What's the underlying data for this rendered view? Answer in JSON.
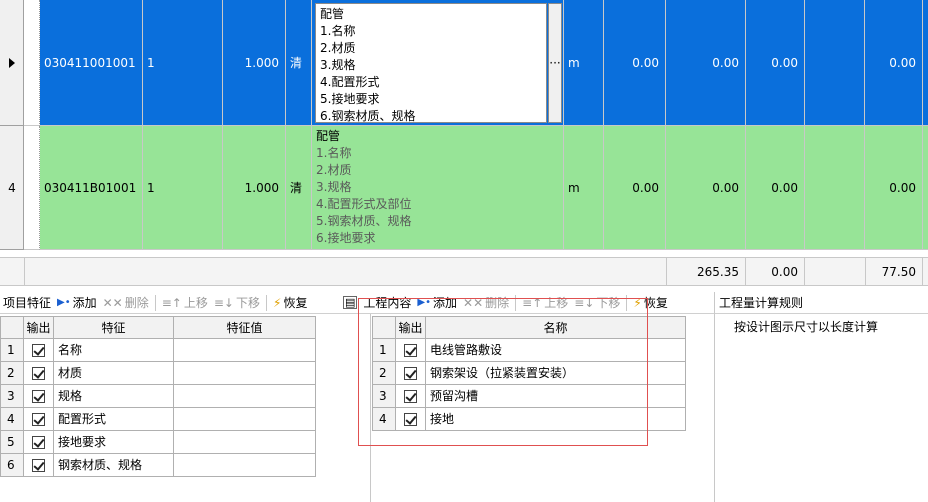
{
  "rows": [
    {
      "row_num": "",
      "code": "030411001001",
      "qty": "1",
      "amount": "1.000",
      "type": "清",
      "desc_title": "配管",
      "desc_items": [
        "1.名称",
        "2.材质",
        "3.规格",
        "4.配置形式",
        "5.接地要求",
        "6.钢索材质、规格"
      ],
      "ellipsis": "···",
      "unit": "m",
      "v1": "0.00",
      "v2": "0.00",
      "v3": "0.00",
      "v4": "0.00"
    },
    {
      "row_num": "4",
      "code": "030411B01001",
      "qty": "1",
      "amount": "1.000",
      "type": "清",
      "desc_title": "配管",
      "desc_items": [
        "1.名称",
        "2.材质",
        "3.规格",
        "4.配置形式及部位",
        "5.钢索材质、规格",
        "6.接地要求"
      ],
      "unit": "m",
      "v1": "0.00",
      "v2": "0.00",
      "v3": "0.00",
      "v4": "0.00"
    }
  ],
  "totals": {
    "t1": "265.35",
    "t2": "0.00",
    "t3": "77.50"
  },
  "features_panel": {
    "title": "项目特征",
    "add": "添加",
    "delete": "删除",
    "up": "上移",
    "down": "下移",
    "restore": "恢复",
    "headers": {
      "output": "输出",
      "feature": "特征",
      "value": "特征值"
    },
    "rows": [
      {
        "num": "1",
        "name": "名称"
      },
      {
        "num": "2",
        "name": "材质"
      },
      {
        "num": "3",
        "name": "规格"
      },
      {
        "num": "4",
        "name": "配置形式"
      },
      {
        "num": "5",
        "name": "接地要求"
      },
      {
        "num": "6",
        "name": "钢索材质、规格"
      }
    ]
  },
  "work_panel": {
    "title": "工程内容",
    "add": "添加",
    "delete": "删除",
    "up": "上移",
    "down": "下移",
    "restore": "恢复",
    "headers": {
      "output": "输出",
      "name": "名称"
    },
    "rows": [
      {
        "num": "1",
        "name": "电线管路敷设"
      },
      {
        "num": "2",
        "name": "钢索架设（拉紧装置安装）"
      },
      {
        "num": "3",
        "name": "预留沟槽"
      },
      {
        "num": "4",
        "name": "接地"
      }
    ]
  },
  "rule_panel": {
    "title": "工程量计算规则",
    "text": "按设计图示尺寸以长度计算"
  },
  "colors": {
    "selected_row": "#0a6fdc",
    "green_row": "#97e497",
    "highlight_box": "#e05050"
  },
  "icons": [
    "row-pointer-icon",
    "add-icon",
    "delete-icon",
    "move-up-icon",
    "move-down-icon",
    "restore-icon",
    "panel-icon"
  ]
}
